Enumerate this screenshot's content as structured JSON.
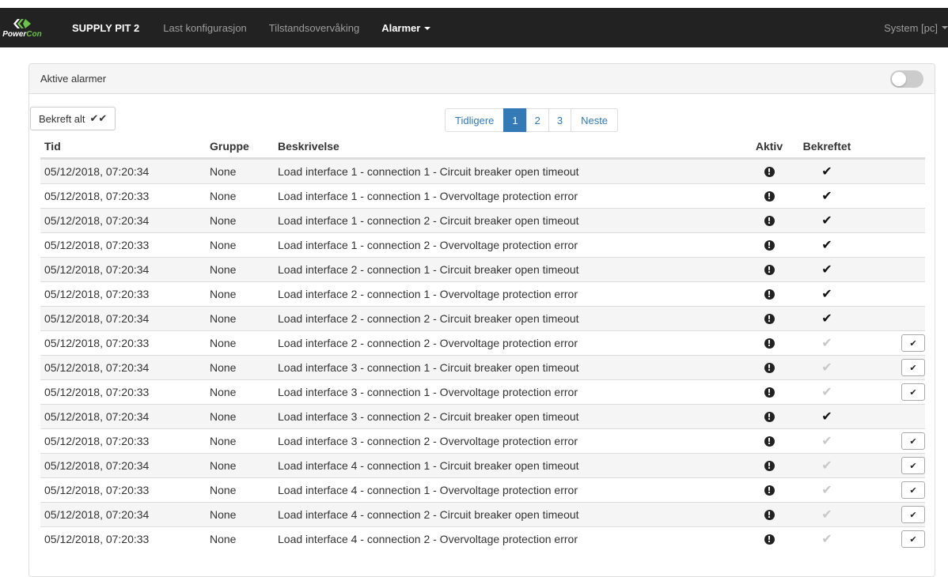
{
  "navbar": {
    "brand_part1": "Power",
    "brand_part2": "Con",
    "title": "SUPPLY PIT 2",
    "links": [
      "Last konfigurasjon",
      "Tilstandsovervåking"
    ],
    "active_menu": "Alarmer",
    "user": "System [pc]"
  },
  "panel": {
    "heading": "Aktive alarmer",
    "toggle_on": false
  },
  "toolbar": {
    "confirm_all_label": "Bekreft alt",
    "confirm_all_icon": "✔✔"
  },
  "pagination": {
    "previous": "Tidligere",
    "pages": [
      "1",
      "2",
      "3"
    ],
    "active_page": "1",
    "next": "Neste"
  },
  "table": {
    "headers": [
      "Tid",
      "Gruppe",
      "Beskrivelse",
      "Aktiv",
      "Bekreftet"
    ],
    "rows": [
      {
        "time": "05/12/2018, 07:20:34",
        "group": "None",
        "description": "Load interface 1 - connection 1 - Circuit breaker open timeout",
        "active": true,
        "confirmed": true
      },
      {
        "time": "05/12/2018, 07:20:33",
        "group": "None",
        "description": "Load interface 1 - connection 1 - Overvoltage protection error",
        "active": true,
        "confirmed": true
      },
      {
        "time": "05/12/2018, 07:20:34",
        "group": "None",
        "description": "Load interface 1 - connection 2 - Circuit breaker open timeout",
        "active": true,
        "confirmed": true
      },
      {
        "time": "05/12/2018, 07:20:33",
        "group": "None",
        "description": "Load interface 1 - connection 2 - Overvoltage protection error",
        "active": true,
        "confirmed": true
      },
      {
        "time": "05/12/2018, 07:20:34",
        "group": "None",
        "description": "Load interface 2 - connection 1 - Circuit breaker open timeout",
        "active": true,
        "confirmed": true
      },
      {
        "time": "05/12/2018, 07:20:33",
        "group": "None",
        "description": "Load interface 2 - connection 1 - Overvoltage protection error",
        "active": true,
        "confirmed": true
      },
      {
        "time": "05/12/2018, 07:20:34",
        "group": "None",
        "description": "Load interface 2 - connection 2 - Circuit breaker open timeout",
        "active": true,
        "confirmed": true
      },
      {
        "time": "05/12/2018, 07:20:33",
        "group": "None",
        "description": "Load interface 2 - connection 2 - Overvoltage protection error",
        "active": true,
        "confirmed": false
      },
      {
        "time": "05/12/2018, 07:20:34",
        "group": "None",
        "description": "Load interface 3 - connection 1 - Circuit breaker open timeout",
        "active": true,
        "confirmed": false
      },
      {
        "time": "05/12/2018, 07:20:33",
        "group": "None",
        "description": "Load interface 3 - connection 1 - Overvoltage protection error",
        "active": true,
        "confirmed": false
      },
      {
        "time": "05/12/2018, 07:20:34",
        "group": "None",
        "description": "Load interface 3 - connection 2 - Circuit breaker open timeout",
        "active": true,
        "confirmed": true
      },
      {
        "time": "05/12/2018, 07:20:33",
        "group": "None",
        "description": "Load interface 3 - connection 2 - Overvoltage protection error",
        "active": true,
        "confirmed": false
      },
      {
        "time": "05/12/2018, 07:20:34",
        "group": "None",
        "description": "Load interface 4 - connection 1 - Circuit breaker open timeout",
        "active": true,
        "confirmed": false
      },
      {
        "time": "05/12/2018, 07:20:33",
        "group": "None",
        "description": "Load interface 4 - connection 1 - Overvoltage protection error",
        "active": true,
        "confirmed": false
      },
      {
        "time": "05/12/2018, 07:20:34",
        "group": "None",
        "description": "Load interface 4 - connection 2 - Circuit breaker open timeout",
        "active": true,
        "confirmed": false
      },
      {
        "time": "05/12/2018, 07:20:33",
        "group": "None",
        "description": "Load interface 4 - connection 2 - Overvoltage protection error",
        "active": true,
        "confirmed": false
      }
    ]
  },
  "icons": {
    "active": "exclamation-circle-icon",
    "confirmed": "check-icon",
    "acknowledge": "check-icon"
  },
  "colors": {
    "navbar_bg": "#222222",
    "brand_green": "#6cc24a",
    "primary": "#337ab7",
    "stripe": "#f5f5f5"
  }
}
